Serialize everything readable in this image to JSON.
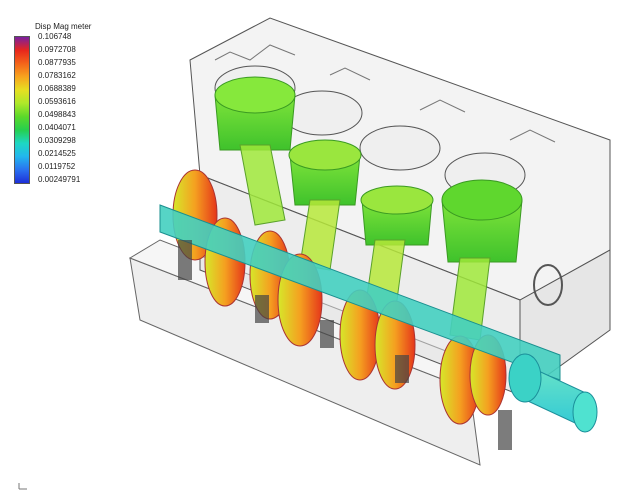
{
  "legend": {
    "title": "Disp Mag meter",
    "values": [
      "0.106748",
      "0.0972708",
      "0.0877935",
      "0.0783162",
      "0.0688389",
      "0.0593616",
      "0.0498843",
      "0.0404071",
      "0.0309298",
      "0.0214525",
      "0.0119752",
      "0.00249791"
    ],
    "colors": [
      "#7a1fa0",
      "#e8261c",
      "#f4641a",
      "#f7a41e",
      "#e6df22",
      "#aee82a",
      "#5cd92a",
      "#26cf4e",
      "#1ed7c3",
      "#22b7ee",
      "#2a72f0",
      "#1e2fd8"
    ]
  },
  "model": {
    "name": "engine-block-displacement-model"
  }
}
